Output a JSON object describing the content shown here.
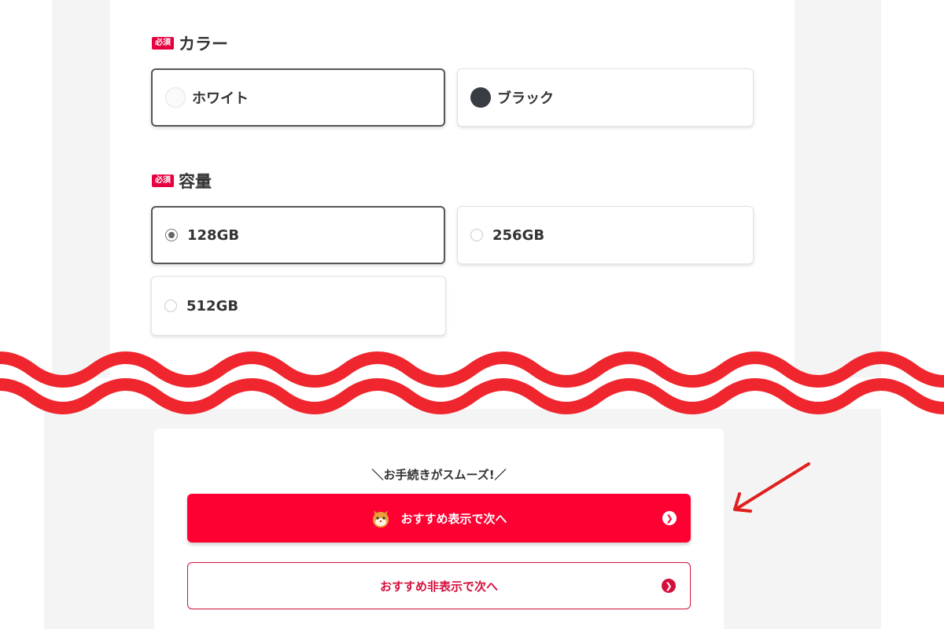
{
  "color_section": {
    "required_badge": "必須",
    "title": "カラー",
    "options": [
      {
        "label": "ホワイト",
        "swatch": "#fafafa",
        "selected": true
      },
      {
        "label": "ブラック",
        "swatch": "#393c42",
        "selected": false
      }
    ]
  },
  "capacity_section": {
    "required_badge": "必須",
    "title": "容量",
    "options": [
      {
        "label": "128GB",
        "selected": true
      },
      {
        "label": "256GB",
        "selected": false
      },
      {
        "label": "512GB",
        "selected": false
      }
    ]
  },
  "cta": {
    "tagline": "＼お手続きがスムーズ!／",
    "primary_button": "おすすめ表示で次へ",
    "secondary_button": "おすすめ非表示で次へ"
  },
  "colors": {
    "required_badge": "#e6003e",
    "primary": "#ff0033",
    "secondary_border": "#d40f3c",
    "wave": "#f0262e",
    "annotation_arrow": "#e0201f"
  },
  "icons": {
    "primary_button_mascot": "cat-mascot-icon",
    "button_chevron": "chevron-right-circle-icon",
    "annotation": "red-arrow-icon",
    "divider": "wavy-break-divider"
  }
}
